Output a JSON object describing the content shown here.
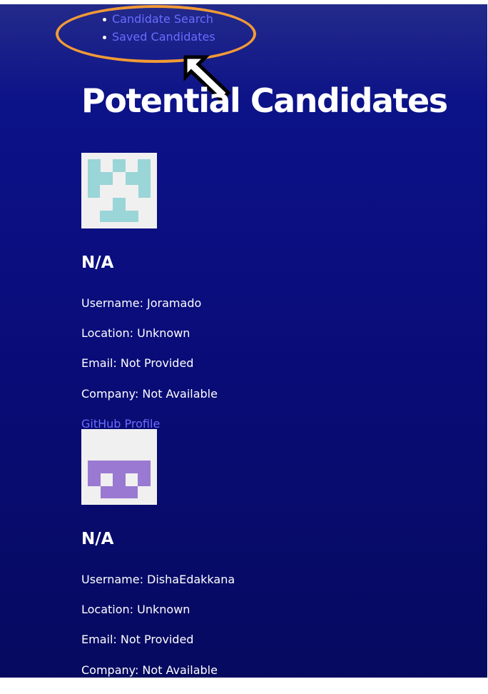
{
  "nav": {
    "items": [
      {
        "label": "Candidate Search"
      },
      {
        "label": "Saved Candidates"
      }
    ]
  },
  "page_title": "Potential Candidates",
  "candidates": [
    {
      "name": "N/A",
      "username": "Username: Joramado",
      "location": "Location: Unknown",
      "email": "Email: Not Provided",
      "company": "Company: Not Available",
      "profile_link": "GitHub Profile",
      "avatar_color": "#9ad5d8"
    },
    {
      "name": "N/A",
      "username": "Username: DishaEdakkana",
      "location": "Location: Unknown",
      "email": "Email: Not Provided",
      "company": "Company: Not Available",
      "avatar_color": "#9979d1"
    }
  ],
  "colors": {
    "link": "#6b6cff",
    "highlight_ring": "#f29a36",
    "background_top": "#232a8a",
    "background_bottom": "#060a5f"
  }
}
